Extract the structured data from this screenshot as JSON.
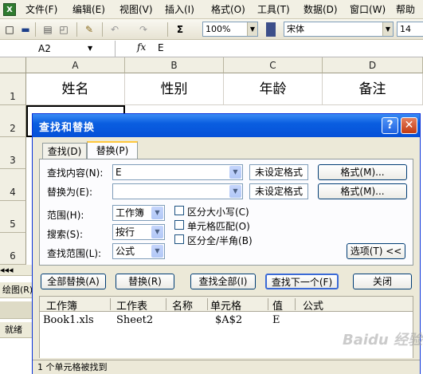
{
  "menubar": {
    "items": [
      "文件(F)",
      "编辑(E)",
      "视图(V)",
      "插入(I)",
      "格式(O)",
      "工具(T)",
      "数据(D)",
      "窗口(W)",
      "帮助"
    ]
  },
  "toolbar": {
    "zoom": "100%",
    "font": "宋体",
    "font_size": "14",
    "sigma": "Σ"
  },
  "formula_bar": {
    "name_box": "A2",
    "fx": "fx",
    "content": "E"
  },
  "sheet": {
    "columns": [
      "A",
      "B",
      "C",
      "D"
    ],
    "rows": [
      "1",
      "2",
      "3",
      "4",
      "5",
      "6"
    ],
    "header_cells": [
      "姓名",
      "性别",
      "年龄",
      "备注"
    ]
  },
  "left_strip": {
    "drawing": "绘图(R)",
    "ready": "就绪"
  },
  "dialog": {
    "title": "查找和替换",
    "tabs": [
      "查找(D)",
      "替换(P)"
    ],
    "find_label": "查找内容(N):",
    "find_value": "E",
    "replace_label": "替换为(E):",
    "replace_value": "",
    "format_status": "未设定格式",
    "format_button": "格式(M)...",
    "within_label": "范围(H):",
    "within_value": "工作簿",
    "search_label": "搜索(S):",
    "search_value": "按行",
    "lookin_label": "查找范围(L):",
    "lookin_value": "公式",
    "match_case": "区分大小写(C)",
    "match_cell": "单元格匹配(O)",
    "match_byte": "区分全/半角(B)",
    "options_button": "选项(T) <<",
    "replace_all": "全部替换(A)",
    "replace": "替换(R)",
    "find_all": "查找全部(I)",
    "find_next": "查找下一个(F)",
    "close": "关闭",
    "results_headers": [
      "工作簿",
      "工作表",
      "名称",
      "单元格",
      "值",
      "公式"
    ],
    "results_row": {
      "book": "Book1.xls",
      "sheet": "Sheet2",
      "name": "",
      "cell": "$A$2",
      "value": "E",
      "formula": ""
    },
    "status": "1 个单元格被找到"
  },
  "watermark": "Baidu 经验",
  "colors": {
    "title_bar": "#0a5ee0",
    "dialog_bg": "#ece9d8",
    "menu_bg": "#f2f0e4"
  }
}
